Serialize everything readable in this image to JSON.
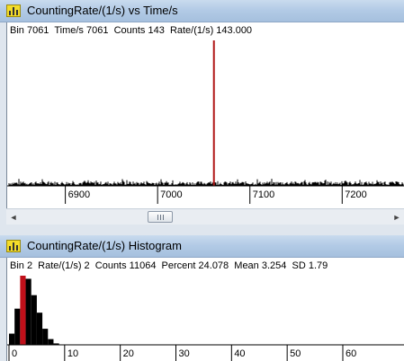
{
  "colors": {
    "marker": "#b01818",
    "bars": "#000000",
    "highlight_bar": "#c0101a",
    "titlebar": "#b3cbe6",
    "window_bg": "#dfe6ee"
  },
  "top_window": {
    "title": "CountingRate/(1/s) vs Time/s",
    "icon": "bar-chart-icon",
    "status": "Bin 7061  Time/s 7061  Counts 143  Rate/(1/s) 143.000"
  },
  "bottom_window": {
    "title": "CountingRate/(1/s) Histogram",
    "icon": "bar-chart-icon",
    "status": "Bin 2  Rate/(1/s) 2  Counts 11064  Percent 24.078  Mean 3.254  SD 1.79"
  },
  "scrollbar": {
    "left_arrow": "◄",
    "right_arrow": "►"
  },
  "chart_data": [
    {
      "type": "line",
      "title": "CountingRate/(1/s) vs Time/s",
      "xlabel": "",
      "ylabel": "",
      "x_ticks": [
        6900,
        7000,
        7100,
        7200
      ],
      "xlim": [
        6837,
        7267
      ],
      "cursor": {
        "x": 7061,
        "y": 143
      },
      "background_level_approx": [
        1,
        5
      ],
      "grid": false
    },
    {
      "type": "bar",
      "title": "CountingRate/(1/s) Histogram",
      "xlabel": "",
      "ylabel": "",
      "x_ticks": [
        0,
        10,
        20,
        30,
        40,
        50,
        60
      ],
      "xlim": [
        0,
        71
      ],
      "categories": [
        0,
        1,
        2,
        3,
        4,
        5,
        6,
        7,
        8,
        9
      ],
      "percent_values": [
        3.9,
        12.6,
        24.078,
        23.0,
        17.3,
        11.2,
        5.6,
        2.0,
        0.5,
        0.1
      ],
      "selected_bin": 2,
      "grid": false
    }
  ]
}
